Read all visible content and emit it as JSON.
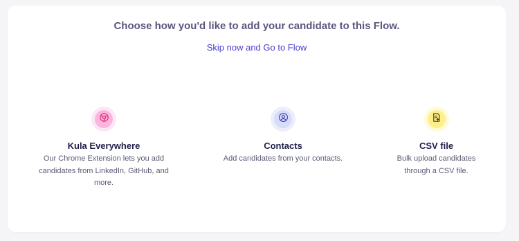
{
  "header": {
    "title": "Choose how you'd like to add your candidate to this Flow.",
    "skip_link": "Skip now and Go to Flow"
  },
  "options": [
    {
      "title": "Kula Everywhere",
      "description": "Our Chrome Extension lets you add candidates from LinkedIn, GitHub, and more.",
      "icon": "chrome-icon",
      "ring_color": "#fde7f4",
      "inner_color": "#fbb6dd",
      "icon_color": "#db2777"
    },
    {
      "title": "Contacts",
      "description": "Add candidates from your contacts.",
      "icon": "user-circle-icon",
      "ring_color": "#eceefc",
      "inner_color": "#d7dcf8",
      "icon_color": "#3c3fb8"
    },
    {
      "title": "CSV file",
      "description": "Bulk upload candidates through a CSV file.",
      "icon": "csv-file-icon",
      "ring_color": "#fefbd6",
      "inner_color": "#fdf08a",
      "icon_color": "#4d3a12"
    }
  ]
}
